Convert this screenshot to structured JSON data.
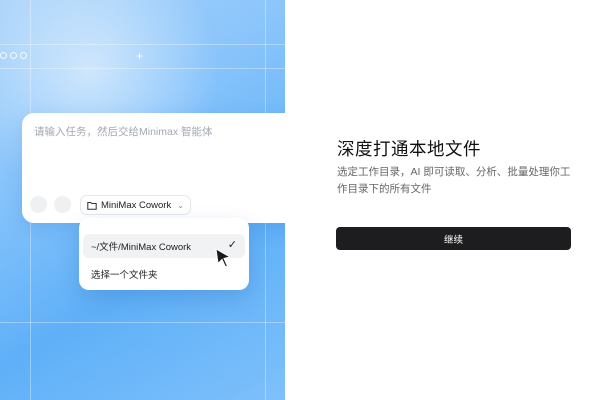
{
  "illustration": {
    "prompt_placeholder": "请输入任务，然后交给Minimax 智能体",
    "folder_chip_label": "MiniMax Cowork",
    "dropdown": {
      "items": [
        {
          "label": "~/文件/MiniMax Cowork",
          "selected": true
        },
        {
          "label": "选择一个文件夹",
          "selected": false
        }
      ]
    },
    "icons": [
      "folder-icon",
      "chevron-down-icon",
      "checkmark-icon",
      "cursor-arrow-icon"
    ],
    "colors": {
      "gradient_start": "#a9d3fa",
      "gradient_end": "#5fb0f8"
    }
  },
  "onboarding": {
    "title": "深度打通本地文件",
    "description": "选定工作目录，AI 即可读取、分析、批量处理你工作目录下的所有文件",
    "continue_label": "继续"
  },
  "colors": {
    "button_bg": "#1d1d1f",
    "button_text": "#ffffff",
    "title": "#111111",
    "body_text": "#666666"
  }
}
